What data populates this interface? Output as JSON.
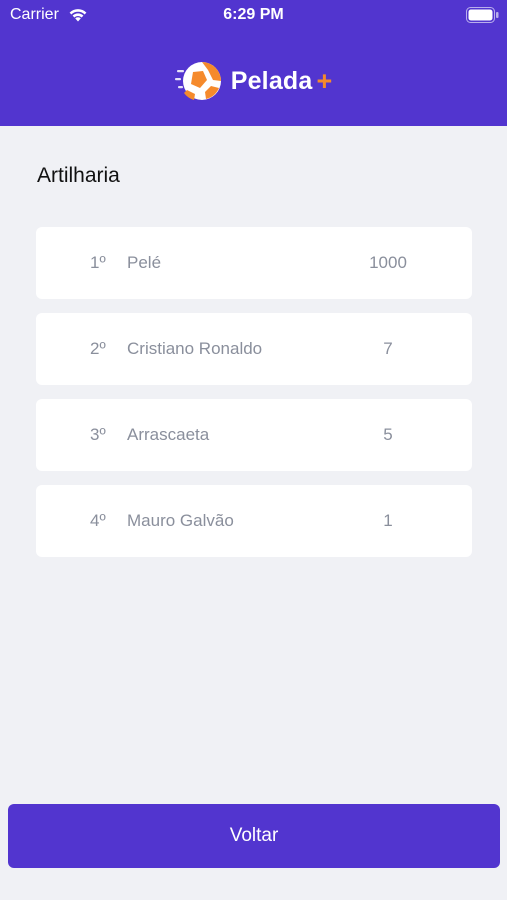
{
  "status_bar": {
    "carrier": "Carrier",
    "time": "6:29 PM"
  },
  "brand": {
    "name": "Pelada",
    "plus": "+",
    "logo_icon": "soccer-ball-icon",
    "accent_color": "#f58a2c"
  },
  "colors": {
    "primary": "#5235cf",
    "background": "#f0f1f5",
    "row_text": "#8a8f9c"
  },
  "page": {
    "title": "Artilharia"
  },
  "scorers": [
    {
      "position": "1º",
      "name": "Pelé",
      "goals": "1000"
    },
    {
      "position": "2º",
      "name": "Cristiano Ronaldo",
      "goals": "7"
    },
    {
      "position": "3º",
      "name": "Arrascaeta",
      "goals": "5"
    },
    {
      "position": "4º",
      "name": "Mauro Galvão",
      "goals": "1"
    }
  ],
  "footer": {
    "back_label": "Voltar"
  }
}
